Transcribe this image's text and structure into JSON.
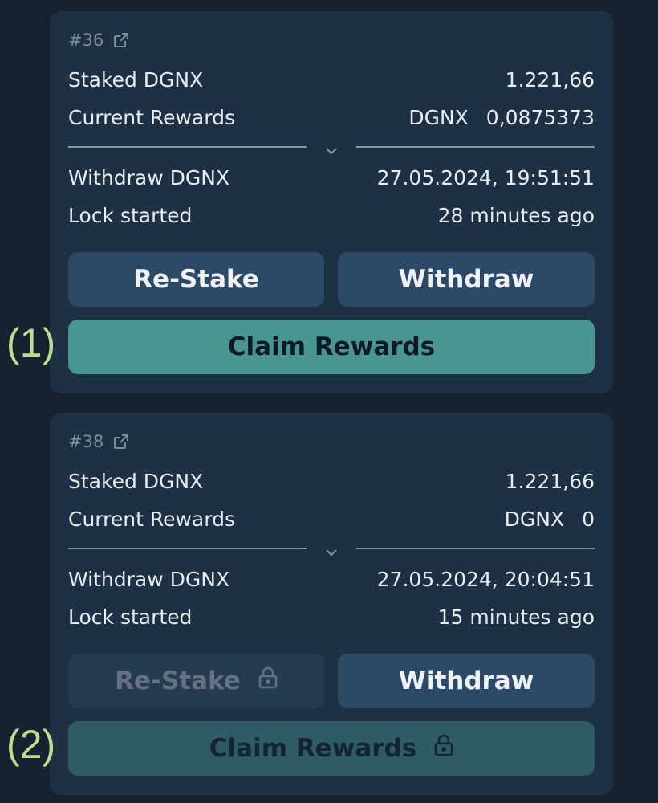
{
  "colors": {
    "background": "#16222f",
    "card": "#1e3044",
    "button": "#2c4a67",
    "claim_active": "#479690",
    "claim_disabled": "#2e5b64",
    "marker": "#b9de8e"
  },
  "cards": [
    {
      "id_label": "#36",
      "staked_label": "Staked DGNX",
      "staked_value": "1.221,66",
      "rewards_label": "Current Rewards",
      "rewards_currency": "DGNX",
      "rewards_value": "0,0875373",
      "withdraw_label": "Withdraw DGNX",
      "withdraw_value": "27.05.2024, 19:51:51",
      "lock_label": "Lock started",
      "lock_value": "28 minutes ago",
      "restake_label": "Re-Stake",
      "withdraw_button_label": "Withdraw",
      "claim_label": "Claim Rewards"
    },
    {
      "id_label": "#38",
      "staked_label": "Staked DGNX",
      "staked_value": "1.221,66",
      "rewards_label": "Current Rewards",
      "rewards_currency": "DGNX",
      "rewards_value": "0",
      "withdraw_label": "Withdraw DGNX",
      "withdraw_value": "27.05.2024, 20:04:51",
      "lock_label": "Lock started",
      "lock_value": "15 minutes ago",
      "restake_label": "Re-Stake",
      "withdraw_button_label": "Withdraw",
      "claim_label": "Claim Rewards"
    }
  ],
  "markers": [
    "(1)",
    "(2)"
  ],
  "icons": {
    "external_link": "external-link-icon",
    "chevron": "chevron-down-icon",
    "lock": "lock-icon"
  }
}
